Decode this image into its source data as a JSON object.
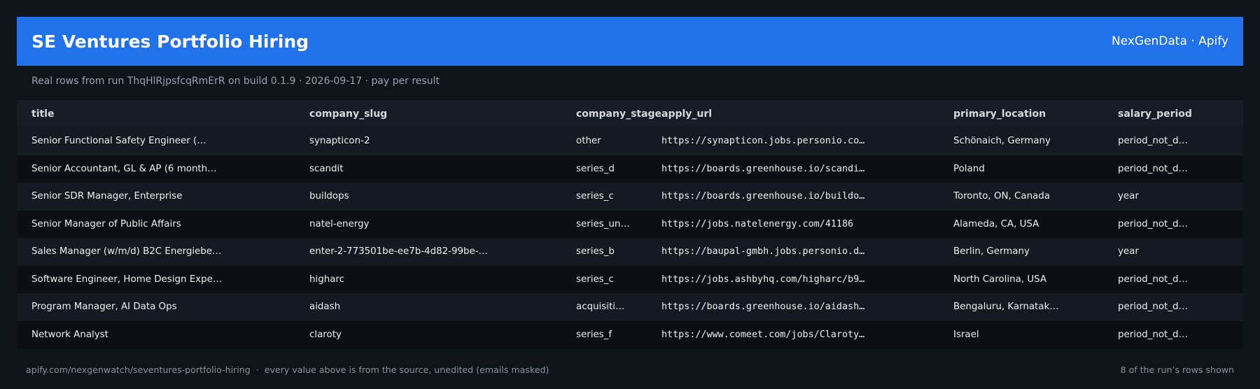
{
  "header": {
    "title": "SE Ventures Portfolio Hiring",
    "brand": "NexGenData · Apify"
  },
  "subtitle": "Real rows from run ThqHlRjpsfcqRmErR on build 0.1.9 · 2026-09-17 · pay per result",
  "table": {
    "columns": [
      "title",
      "company_slug",
      "company_stage",
      "apply_url",
      "primary_location",
      "salary_period"
    ],
    "rows": [
      {
        "title": "Senior Functional Safety Engineer (…",
        "company_slug": "synapticon-2",
        "company_stage": "other",
        "apply_url": "https://synapticon.jobs.personio.co…",
        "primary_location": "Schönaich, Germany",
        "salary_period": "period_not_d…"
      },
      {
        "title": "Senior Accountant, GL & AP (6 month…",
        "company_slug": "scandit",
        "company_stage": "series_d",
        "apply_url": "https://boards.greenhouse.io/scandi…",
        "primary_location": "Poland",
        "salary_period": "period_not_d…"
      },
      {
        "title": "Senior SDR Manager, Enterprise",
        "company_slug": "buildops",
        "company_stage": "series_c",
        "apply_url": "https://boards.greenhouse.io/buildo…",
        "primary_location": "Toronto, ON, Canada",
        "salary_period": "year"
      },
      {
        "title": "Senior Manager of Public Affairs",
        "company_slug": "natel-energy",
        "company_stage": "series_un…",
        "apply_url": "https://jobs.natelenergy.com/41186",
        "primary_location": "Alameda, CA, USA",
        "salary_period": "period_not_d…"
      },
      {
        "title": "Sales Manager (w/m/d) B2C Energiebe…",
        "company_slug": "enter-2-773501be-ee7b-4d82-99be-…",
        "company_stage": "series_b",
        "apply_url": "https://baupal-gmbh.jobs.personio.d…",
        "primary_location": "Berlin, Germany",
        "salary_period": "year"
      },
      {
        "title": "Software Engineer, Home Design Expe…",
        "company_slug": "higharc",
        "company_stage": "series_c",
        "apply_url": "https://jobs.ashbyhq.com/higharc/b9…",
        "primary_location": "North Carolina, USA",
        "salary_period": "period_not_d…"
      },
      {
        "title": "Program Manager, AI Data Ops",
        "company_slug": "aidash",
        "company_stage": "acquisiti…",
        "apply_url": "https://boards.greenhouse.io/aidash…",
        "primary_location": "Bengaluru, Karnatak…",
        "salary_period": "period_not_d…"
      },
      {
        "title": "Network Analyst",
        "company_slug": "claroty",
        "company_stage": "series_f",
        "apply_url": "https://www.comeet.com/jobs/Claroty…",
        "primary_location": "Israel",
        "salary_period": "period_not_d…"
      }
    ]
  },
  "footer": {
    "left": "apify.com/nexgenwatch/seventures-portfolio-hiring  ·  every value above is from the source, unedited (emails masked)",
    "right": "8 of the run’s rows shown"
  },
  "colors": {
    "background": "#0f141b",
    "header": "#2171ea",
    "url": "#3fb950"
  }
}
